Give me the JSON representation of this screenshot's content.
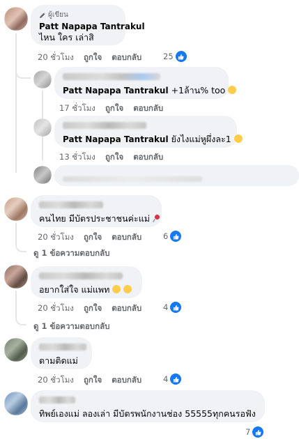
{
  "comments": [
    {
      "author_badge": "ผู้เขียน",
      "author": "Patt Napapa Tantrakul",
      "text": "ไหน ใคร เล่าสิ",
      "time": "20 ชั่วโมง",
      "like": "ถูกใจ",
      "reply": "ตอบกลับ",
      "reactions": "25"
    },
    {
      "mention": "Patt Napapa Tantrakul",
      "text": " +1ล้าน% too",
      "time": "17 ชั่วโมง",
      "like": "ถูกใจ",
      "reply": "ตอบกลับ"
    },
    {
      "mention": "Patt Napapa Tantrakul",
      "text": " ยังไงแม่หูผึ่งละ1",
      "time": "13 ชั่วโมง",
      "like": "ถูกใจ",
      "reply": "ตอบกลับ"
    },
    {
      "text": "คนไทย มีบัตรประชาชนค่ะแม่",
      "time": "20 ชั่วโมง",
      "like": "ถูกใจ",
      "reply": "ตอบกลับ",
      "reactions": "6"
    },
    {
      "text": "อยากใส่ใจ แม่แพท",
      "time": "20 ชั่วโมง",
      "like": "ถูกใจ",
      "reply": "ตอบกลับ",
      "reactions": "4"
    },
    {
      "text": "ตามติดแม่",
      "time": "20 ชั่วโมง",
      "like": "ถูกใจ",
      "reply": "ตอบกลับ",
      "reactions": "4"
    },
    {
      "text": "ทิพย์เองแม่ ลองเล่า มีบัตรพนักงานช่อง 55555ทุกคนรอฟัง",
      "reactions": "7"
    }
  ],
  "view_replies": [
    "ดู 1 ข้อความตอบกลับ",
    "ดู 1 ข้อความตอบกลับ"
  ],
  "icons": {
    "like": "like-thumb-icon",
    "pencil": "pencil-icon",
    "reply_arrow": "reply-arrow-icon"
  },
  "colors": {
    "like_blue": "#1877f2",
    "bubble": "#f0f2f5",
    "meta": "#65676b"
  }
}
